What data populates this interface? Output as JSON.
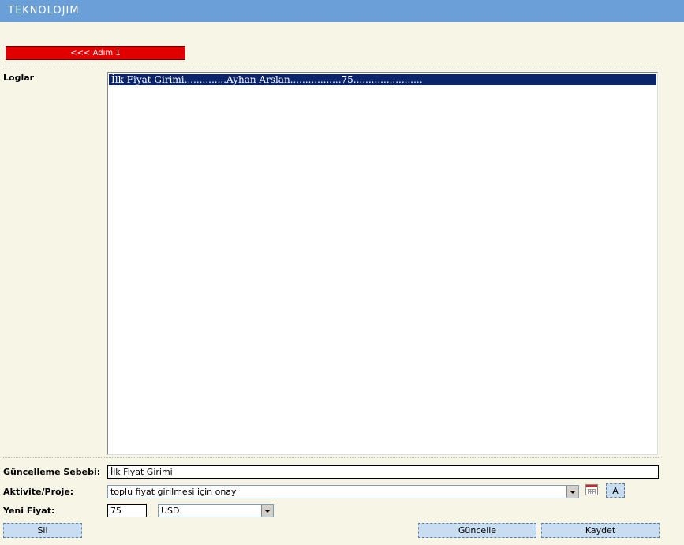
{
  "header": {
    "logo_prefix": "T",
    "logo_e": "E",
    "logo_rest": "KNOLOJIM"
  },
  "step_button": {
    "label": "<<< Adım 1"
  },
  "logs": {
    "label": "Loglar",
    "entries": [
      "İlk Fiyat Girimi..............Ayhan Arslan.................75......................."
    ]
  },
  "form": {
    "reason": {
      "label": "Güncelleme Sebebi:",
      "value": "İlk Fiyat Girimi"
    },
    "activity": {
      "label": "Aktivite/Proje:",
      "value": "toplu fiyat girilmesi için onay",
      "a_label": "A"
    },
    "price": {
      "label": "Yeni Fiyat:",
      "value": "75",
      "currency": "USD"
    }
  },
  "buttons": {
    "delete": "Sil",
    "update": "Güncelle",
    "save": "Kaydet"
  }
}
